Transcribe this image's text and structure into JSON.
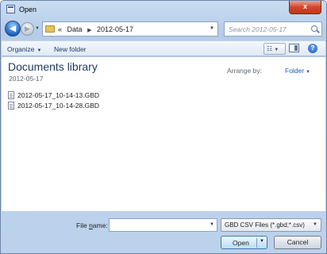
{
  "window": {
    "title": "Open",
    "close_glyph": "x"
  },
  "navigation": {
    "back_glyph": "◀",
    "forward_glyph": "▶",
    "breadcrumb_overflow": "«",
    "breadcrumbs": [
      "Data",
      "2012-05-17"
    ],
    "search_placeholder": "Search 2012-05-17",
    "refresh_glyph": "↻"
  },
  "toolbar": {
    "organize_label": "Organize",
    "new_folder_label": "New folder",
    "views_glyph": "☷",
    "help_glyph": "?"
  },
  "library": {
    "title": "Documents library",
    "subtitle": "2012-05-17",
    "arrange_by_label": "Arrange by:",
    "arrange_by_value": "Folder"
  },
  "files": [
    {
      "name": "2012-05-17_10-14-13.GBD"
    },
    {
      "name": "2012-05-17_10-14-28.GBD"
    }
  ],
  "footer": {
    "file_name_label_pre": "File ",
    "file_name_label_accel": "n",
    "file_name_label_post": "ame:",
    "file_name_value": "",
    "file_type_value": "GBD CSV Files (*.gbd;*.csv)",
    "open_label": "Open",
    "cancel_label": "Cancel"
  },
  "colors": {
    "frame": "#bcd2ec",
    "title_accent": "#1e395b",
    "link": "#1e5bb5",
    "close_button": "#c23718"
  }
}
